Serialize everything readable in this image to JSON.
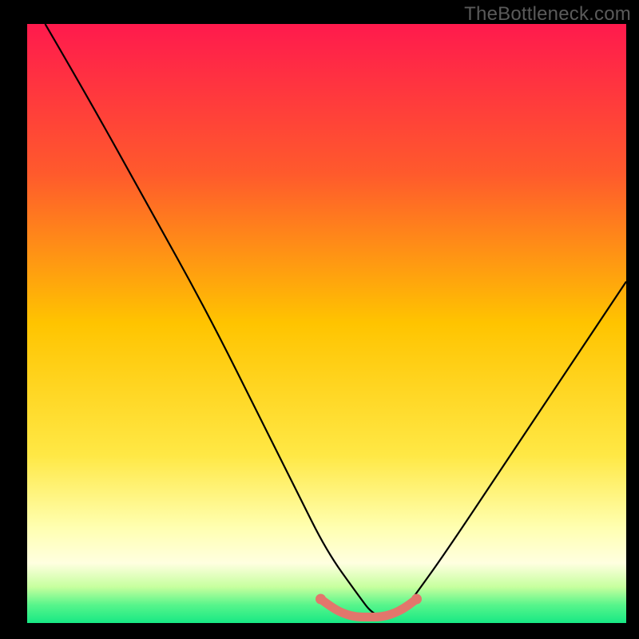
{
  "watermark": "TheBottleneck.com",
  "chart_data": {
    "type": "line",
    "title": "",
    "xlabel": "",
    "ylabel": "",
    "xlim": [
      0,
      100
    ],
    "ylim": [
      0,
      100
    ],
    "series": [
      {
        "name": "bottleneck-curve",
        "x": [
          3,
          10,
          20,
          30,
          40,
          45,
          50,
          55,
          58,
          62,
          65,
          70,
          80,
          90,
          100
        ],
        "values": [
          100,
          88,
          70,
          52,
          32,
          22,
          12,
          5,
          1,
          1,
          5,
          12,
          27,
          42,
          57
        ]
      },
      {
        "name": "bottleneck-floor-marker",
        "x": [
          49,
          51,
          53,
          55,
          57,
          59,
          61,
          63,
          65
        ],
        "values": [
          4.0,
          2.5,
          1.5,
          1.0,
          1.0,
          1.0,
          1.5,
          2.5,
          4.0
        ]
      }
    ],
    "gradient_stops": [
      {
        "offset": 0.0,
        "color": "#ff1a4d"
      },
      {
        "offset": 0.25,
        "color": "#ff5a2c"
      },
      {
        "offset": 0.5,
        "color": "#ffc400"
      },
      {
        "offset": 0.72,
        "color": "#ffe845"
      },
      {
        "offset": 0.84,
        "color": "#ffffb0"
      },
      {
        "offset": 0.9,
        "color": "#ffffe0"
      },
      {
        "offset": 0.94,
        "color": "#c6ff9e"
      },
      {
        "offset": 0.97,
        "color": "#57f58b"
      },
      {
        "offset": 1.0,
        "color": "#17e884"
      }
    ],
    "marker_color": "#e2766c",
    "curve_color": "#000000"
  }
}
